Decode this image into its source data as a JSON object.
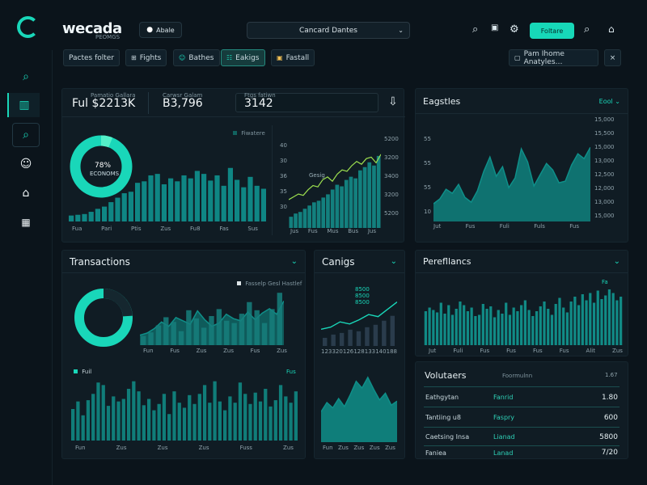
{
  "app": {
    "logo_text": "wecada",
    "logo_subtext": "PEOMGS",
    "app_store_label": "Abale",
    "search_placeholder": "Cancard Dantes",
    "primary_button": "Foltare"
  },
  "filters": [
    {
      "label": "Pactes folter",
      "icon": ""
    },
    {
      "label": "Fights",
      "icon": "⊞"
    },
    {
      "label": "Bathes",
      "icon": "☺"
    },
    {
      "label": "Eakigs",
      "icon": "☷"
    },
    {
      "label": "Fastall",
      "icon": "▣"
    }
  ],
  "right_filter": {
    "label": "Pam Ihome Anatyles…",
    "close": "×"
  },
  "summary": {
    "metric1_label": "Pamatio Gallara",
    "metric1_value": "Ful $2213K",
    "metric2_label": "Carwsr Galam",
    "metric2_value": "B3,796",
    "metric3_label": "Ftgs fatiwn",
    "metric3_value": "3142",
    "download_icon": "download-icon"
  },
  "overview": {
    "donut_value": "78%",
    "donut_sub": "ECONOMS",
    "legend": "Fiwatere",
    "x_labels": [
      "Fua",
      "Pari",
      "Ptis",
      "Zus",
      "Fu8",
      "Fas",
      "Sus"
    ],
    "bars": [
      0.08,
      0.09,
      0.1,
      0.13,
      0.17,
      0.2,
      0.26,
      0.32,
      0.38,
      0.4,
      0.52,
      0.54,
      0.62,
      0.64,
      0.5,
      0.58,
      0.54,
      0.62,
      0.58,
      0.68,
      0.64,
      0.55,
      0.62,
      0.48,
      0.72,
      0.56,
      0.46,
      0.6,
      0.48,
      0.44
    ]
  },
  "mini_chart": {
    "left_axis": [
      "40",
      "30",
      "36",
      "35",
      "30"
    ],
    "right_axis": [
      "5200",
      "3200",
      "3400",
      "3200",
      "5200"
    ],
    "x_labels": [
      "Jus",
      "Fus",
      "Mus",
      "Bus",
      "Jus"
    ],
    "tag": "Gesig",
    "bars": [
      0.14,
      0.18,
      0.2,
      0.24,
      0.28,
      0.32,
      0.34,
      0.38,
      0.42,
      0.48,
      0.54,
      0.52,
      0.6,
      0.64,
      0.62,
      0.72,
      0.76,
      0.82,
      0.78,
      0.9
    ],
    "line": [
      0.4,
      0.44,
      0.48,
      0.46,
      0.54,
      0.6,
      0.58,
      0.68,
      0.72,
      0.66,
      0.76,
      0.82,
      0.8,
      0.88,
      0.94,
      0.9,
      0.98,
      1.0,
      0.92,
      1.04
    ]
  },
  "engagements": {
    "title": "Eagstles",
    "dropdown": "Eool",
    "left_axis": [
      "55",
      "55",
      "55",
      "10"
    ],
    "right_axis": [
      "15,000",
      "15,500",
      "15,000",
      "13,000",
      "12,500",
      "12,000",
      "13,000",
      "15,000"
    ],
    "x_labels": [
      "Jut",
      "Fus",
      "Fuli",
      "Fuls",
      "Fus"
    ],
    "series": [
      0.22,
      0.28,
      0.4,
      0.35,
      0.46,
      0.3,
      0.24,
      0.38,
      0.62,
      0.8,
      0.56,
      0.68,
      0.42,
      0.54,
      0.9,
      0.74,
      0.44,
      0.58,
      0.72,
      0.64,
      0.48,
      0.5,
      0.7,
      0.84,
      0.78,
      0.92
    ]
  },
  "transactions": {
    "title": "Transactions",
    "legend": "Fasselp Gesl Hastlef",
    "x_labels": [
      "Fun",
      "Fus",
      "Zus",
      "Zus",
      "Fus",
      "Zus"
    ],
    "area": [
      0.18,
      0.22,
      0.3,
      0.42,
      0.34,
      0.5,
      0.44,
      0.38,
      0.62,
      0.46,
      0.34,
      0.4,
      0.56,
      0.48,
      0.44,
      0.6,
      0.46,
      0.58,
      0.66,
      0.56,
      0.8
    ],
    "bars": [
      0.16,
      0.22,
      0.34,
      0.48,
      0.4,
      0.24,
      0.6,
      0.46,
      0.3,
      0.5,
      0.62,
      0.42,
      0.38,
      0.54,
      0.74,
      0.6,
      0.38,
      0.62,
      0.9
    ],
    "bottom_legend": "Fuil",
    "bottom_tag": "Fus",
    "bottom_x_labels": [
      "Fun",
      "Zus",
      "Zus",
      "Zus",
      "Fuss",
      "Zus"
    ],
    "bottom_bars": [
      0.5,
      0.62,
      0.4,
      0.64,
      0.74,
      0.92,
      0.88,
      0.55,
      0.7,
      0.62,
      0.66,
      0.82,
      0.94,
      0.78,
      0.56,
      0.66,
      0.48,
      0.58,
      0.74,
      0.42,
      0.78,
      0.6,
      0.52,
      0.72,
      0.58,
      0.74,
      0.88,
      0.6,
      0.94,
      0.62,
      0.48,
      0.7,
      0.6,
      0.92,
      0.74,
      0.58,
      0.76,
      0.62,
      0.82,
      0.54,
      0.64,
      0.88,
      0.7,
      0.6,
      0.78
    ]
  },
  "cangs": {
    "title": "Canigs",
    "axis": [
      "8500",
      "8500",
      "8500"
    ],
    "x_labels": [
      "123",
      "320",
      "126",
      "128",
      "133",
      "140",
      "188"
    ],
    "bars": [
      0.2,
      0.28,
      0.32,
      0.4,
      0.36,
      0.46,
      0.52,
      0.62,
      0.74
    ],
    "line": [
      0.32,
      0.36,
      0.46,
      0.42,
      0.5,
      0.6,
      0.56,
      0.7,
      0.84
    ],
    "x_bottom": [
      "Fun",
      "Zus",
      "Zus",
      "Zus",
      "Zus"
    ],
    "area": [
      0.46,
      0.6,
      0.52,
      0.66,
      0.54,
      0.72,
      0.92,
      0.82,
      0.98,
      0.8,
      0.64,
      0.74,
      0.56,
      0.62
    ]
  },
  "performance": {
    "title": "Perefllancs",
    "tag": "Fa",
    "x_labels": [
      "Jut",
      "Fuli",
      "Fus",
      "Fus",
      "Fus",
      "Fus",
      "Alit",
      "Zus"
    ],
    "bars": [
      0.56,
      0.62,
      0.58,
      0.54,
      0.7,
      0.52,
      0.66,
      0.5,
      0.6,
      0.72,
      0.66,
      0.56,
      0.62,
      0.48,
      0.5,
      0.68,
      0.6,
      0.64,
      0.46,
      0.58,
      0.52,
      0.7,
      0.5,
      0.62,
      0.56,
      0.66,
      0.74,
      0.58,
      0.48,
      0.56,
      0.64,
      0.72,
      0.6,
      0.5,
      0.68,
      0.78,
      0.62,
      0.54,
      0.72,
      0.8,
      0.66,
      0.84,
      0.74,
      0.86,
      0.7,
      0.9,
      0.76,
      0.82,
      0.92,
      0.86,
      0.74,
      0.8
    ]
  },
  "volunteers": {
    "title": "Volutaers",
    "header_mid": "Foormulnn",
    "header_val": "1.67",
    "rows": [
      {
        "name": "Eathgytan",
        "status": "Fanrid",
        "value": "1.80"
      },
      {
        "name": "Tantiing u8",
        "status": "Faspry",
        "value": "600"
      },
      {
        "name": "Caetsing Insa",
        "status": "Lianad",
        "value": "5800"
      },
      {
        "name": "Faniea",
        "status": "Lanad",
        "value": "7/20"
      }
    ]
  },
  "colors": {
    "accent": "#19d7b9",
    "background": "#0b141b",
    "panel": "#101c24",
    "bar": "#0f7d79"
  }
}
